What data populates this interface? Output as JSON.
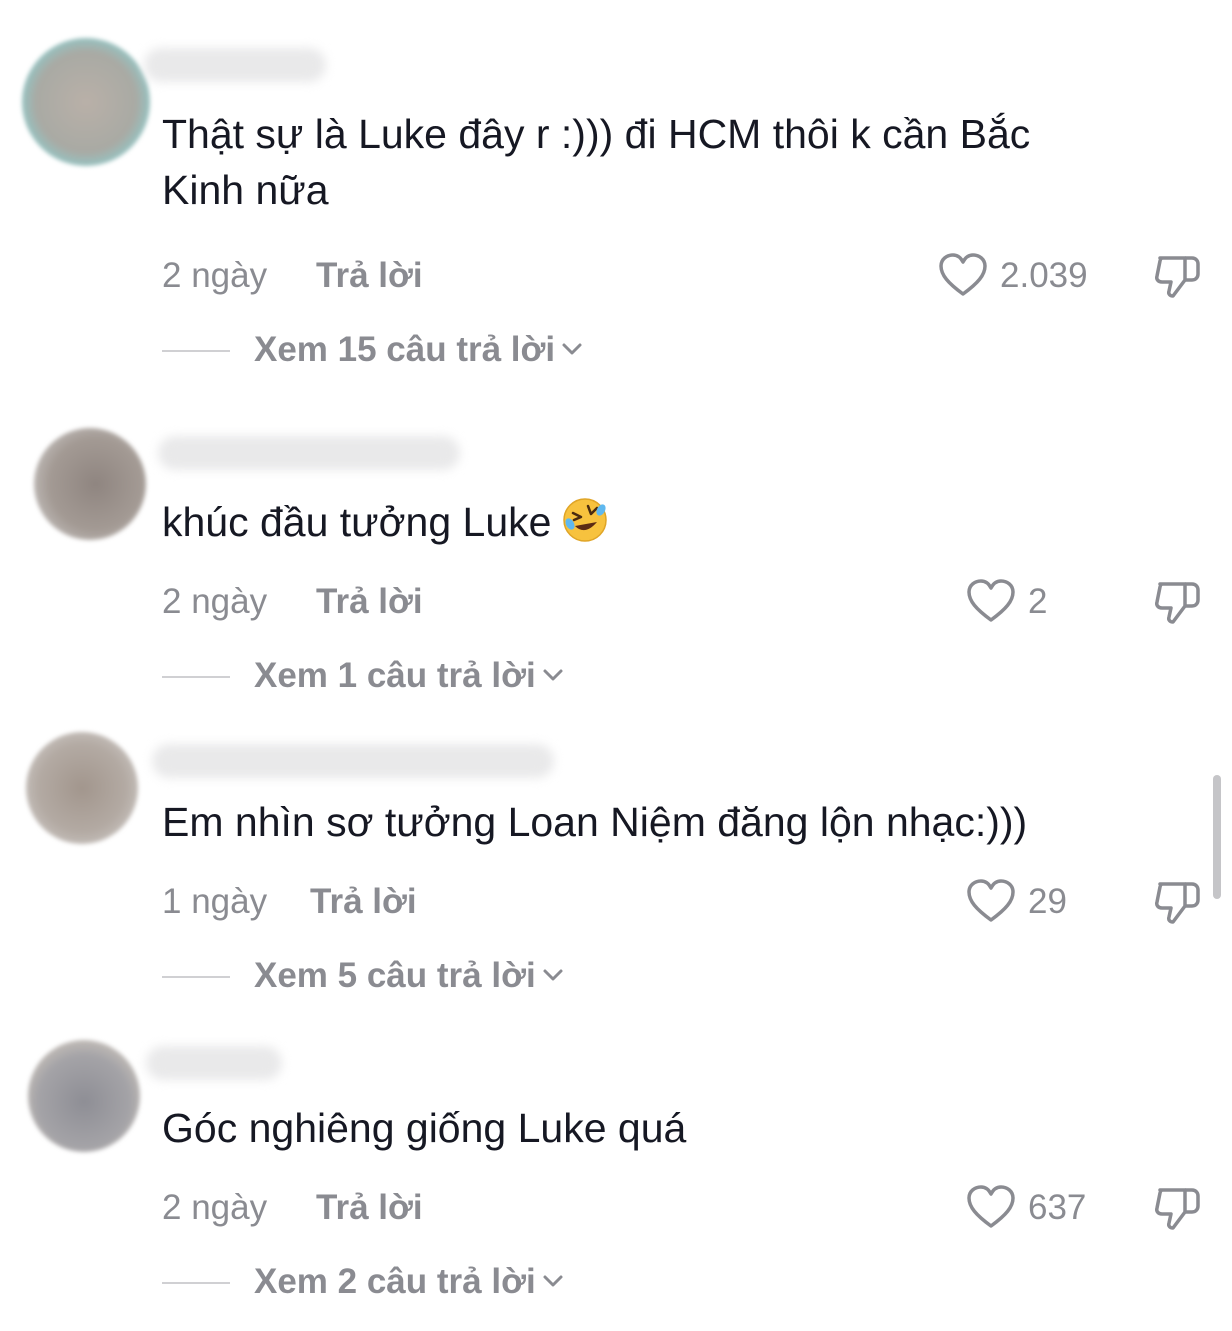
{
  "comments": [
    {
      "text": "Thật sự là Luke đây r :))) đi HCM thôi k cần Bắc Kinh nữa",
      "time": "2 ngày",
      "reply_label": "Trả lời",
      "likes": "2.039",
      "view_replies": "Xem 15 câu trả lời"
    },
    {
      "text": "khúc đầu tưởng Luke",
      "emoji": "rolling-on-floor-laughing",
      "time": "2 ngày",
      "reply_label": "Trả lời",
      "likes": "2",
      "view_replies": "Xem 1 câu trả lời"
    },
    {
      "text": "Em nhìn sơ tưởng Loan Niệm đăng lộn nhạc:)))",
      "time": "1 ngày",
      "reply_label": "Trả lời",
      "likes": "29",
      "view_replies": "Xem 5 câu trả lời"
    },
    {
      "text": "Góc nghiêng giống Luke quá",
      "time": "2 ngày",
      "reply_label": "Trả lời",
      "likes": "637",
      "view_replies": "Xem 2 câu trả lời"
    }
  ],
  "icons": {
    "like": "heart-outline-icon",
    "dislike": "thumbs-down-outline-icon",
    "expand": "chevron-down-icon"
  },
  "colors": {
    "text": "#161823",
    "secondary": "#8a8b91",
    "divider": "#d0d0d3"
  }
}
